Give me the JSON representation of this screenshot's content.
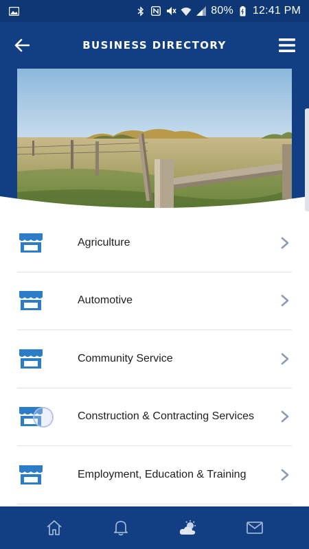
{
  "status_bar": {
    "battery_percent": "80%",
    "time": "12:41 PM",
    "icons": [
      "image-icon",
      "bluetooth-icon",
      "nfc-icon",
      "mute-icon",
      "wifi-icon",
      "signal-icon",
      "battery-icon"
    ]
  },
  "header": {
    "title": "BUSINESS DIRECTORY",
    "back_icon": "back-arrow-icon",
    "menu_icon": "hamburger-menu-icon"
  },
  "hero": {
    "image": "farm-field-fence-photo"
  },
  "categories": [
    {
      "label": "Agriculture",
      "icon": "storefront-icon"
    },
    {
      "label": "Automotive",
      "icon": "storefront-icon"
    },
    {
      "label": "Community Service",
      "icon": "storefront-icon"
    },
    {
      "label": "Construction & Contracting Services",
      "icon": "storefront-icon"
    },
    {
      "label": "Employment, Education & Training",
      "icon": "storefront-icon"
    }
  ],
  "bottom_nav": {
    "items": [
      "home-icon",
      "bell-icon",
      "weather-icon",
      "mail-icon"
    ]
  },
  "colors": {
    "primary": "#123f84",
    "status_bar": "#0e3776",
    "icon_blue": "#2c7cc8",
    "chevron": "#8a9bb3"
  }
}
